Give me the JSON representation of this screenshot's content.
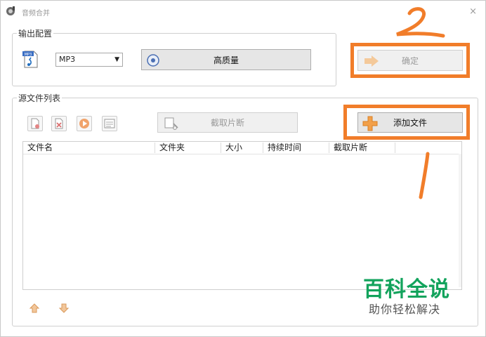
{
  "window": {
    "title": "音频合并"
  },
  "output_group": {
    "legend": "输出配置",
    "format": "MP3",
    "quality_label": "高质量"
  },
  "confirm_button": {
    "label": "确定"
  },
  "source_group": {
    "legend": "源文件列表",
    "clip_label": "截取片断",
    "add_file_label": "添加文件"
  },
  "table": {
    "columns": [
      "文件名",
      "文件夹",
      "大小",
      "持续时间",
      "截取片断"
    ]
  },
  "annotations": {
    "step1": "1",
    "step2": "2"
  },
  "watermark": {
    "title": "百科全说",
    "subtitle": "助你轻松解决"
  },
  "colors": {
    "annotation": "#f17d2a",
    "watermark": "#12a35c"
  }
}
